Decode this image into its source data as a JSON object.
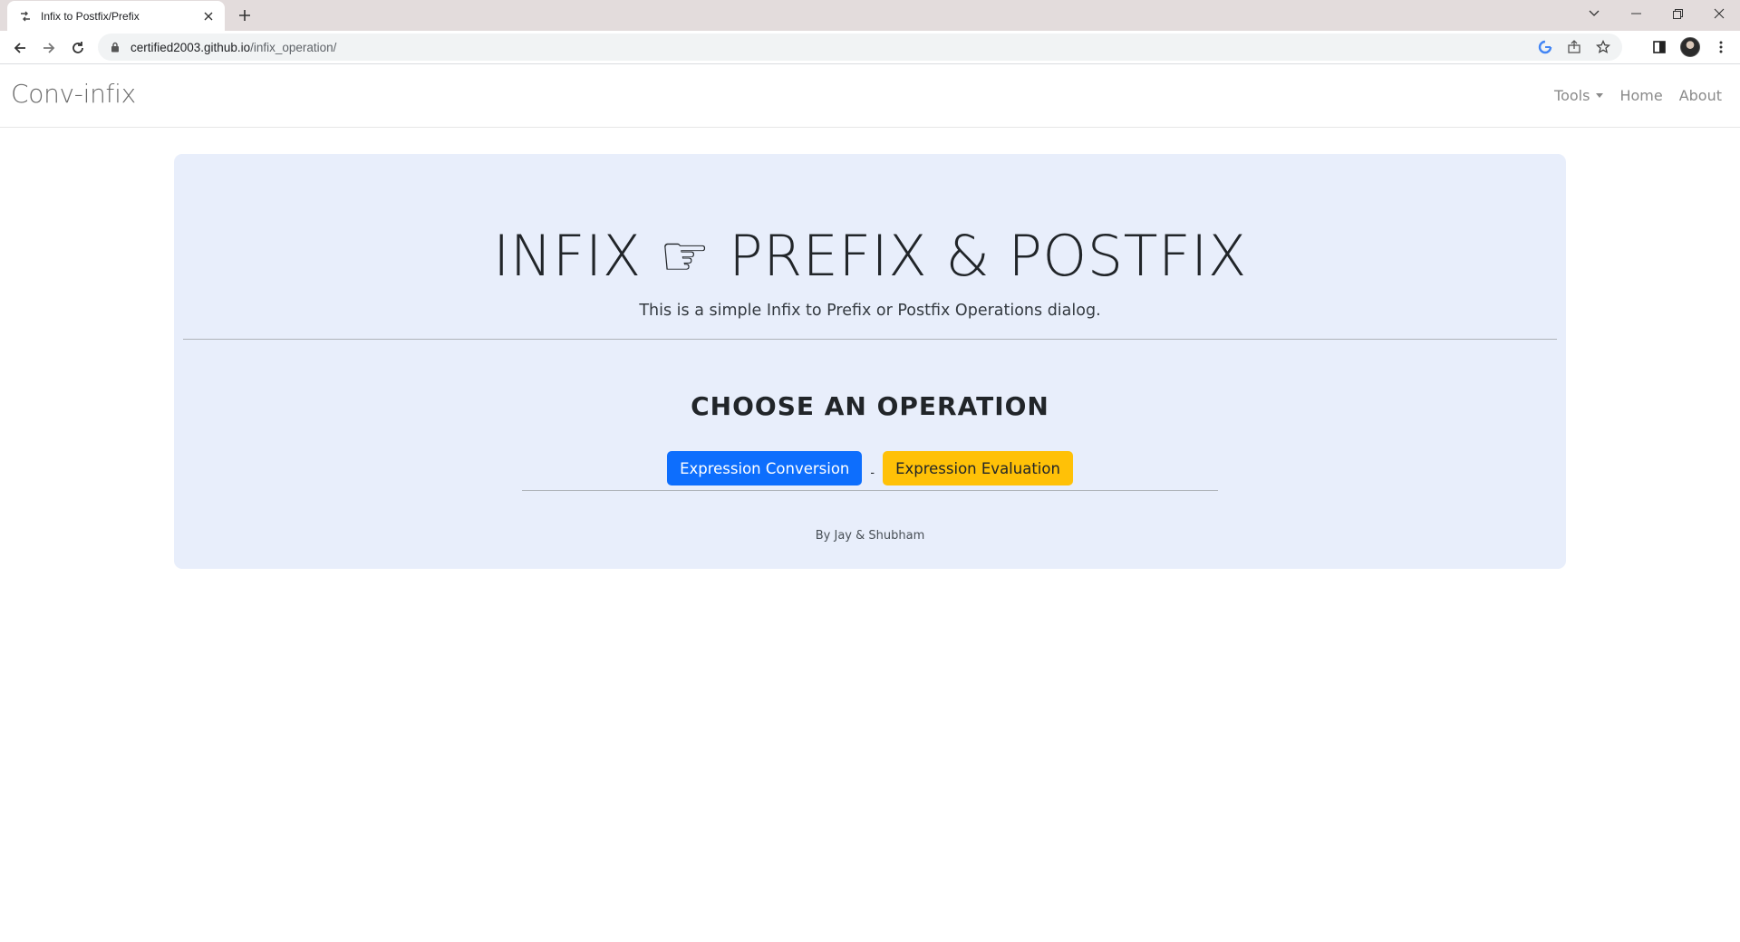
{
  "browser": {
    "tab_title": "Infix to Postfix/Prefix",
    "url_host": "certified2003.github.io",
    "url_path": "/infix_operation/"
  },
  "site": {
    "brand": "Conv-infix",
    "nav": {
      "tools": "Tools",
      "home": "Home",
      "about": "About"
    }
  },
  "hero": {
    "title": "INFIX ☞ PREFIX & POSTFIX",
    "subtitle": "This is a simple Infix to Prefix or Postfix Operations dialog.",
    "choose_heading": "CHOOSE AN OPERATION",
    "button_conversion": "Expression Conversion",
    "separator": "-",
    "button_evaluation": "Expression Evaluation",
    "byline": "By Jay & Shubham"
  },
  "colors": {
    "primary": "#0d6efd",
    "warning": "#ffc107",
    "jumbotron_bg": "#e8eefb"
  }
}
